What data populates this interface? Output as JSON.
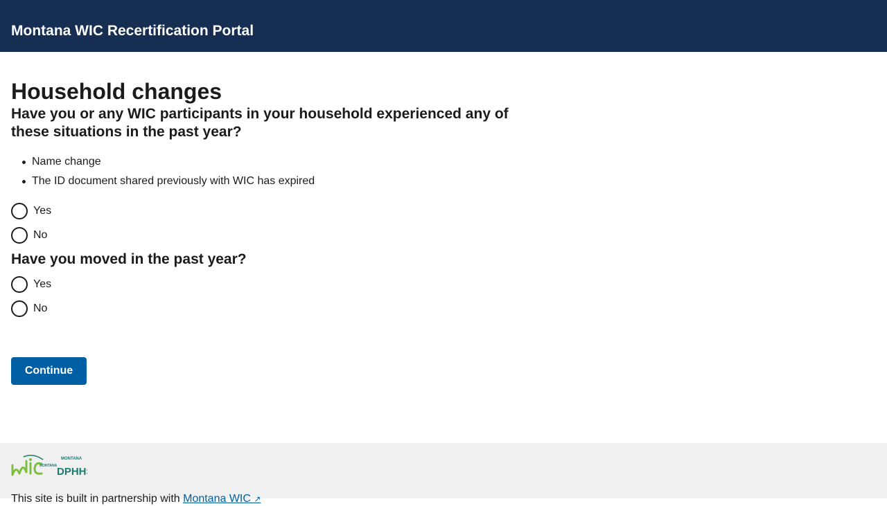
{
  "header": {
    "title": "Montana WIC Recertification Portal"
  },
  "main": {
    "page_title": "Household changes",
    "question1": {
      "text": "Have you or any WIC participants in your household experienced any of these situations in the past year?",
      "items": [
        "Name change",
        "The ID document shared previously with WIC has expired"
      ],
      "options": [
        "Yes",
        "No"
      ]
    },
    "question2": {
      "text": "Have you moved in the past year?",
      "options": [
        "Yes",
        "No"
      ]
    },
    "continue_label": "Continue"
  },
  "footer": {
    "logo1_small": "MONTANA",
    "logo2_small": "MONTANA",
    "logo2_main": "DPHHS",
    "text": "This site is built in partnership with",
    "link_text": "Montana WIC",
    "ext_icon": "↗",
    "colors": {
      "wic_green": "#7cbf3f",
      "dphhs_teal": "#1a7a6e"
    }
  },
  "colors": {
    "header_bg": "#162e51",
    "button_bg": "#005ea2",
    "footer_bg": "#f0f0f0"
  }
}
